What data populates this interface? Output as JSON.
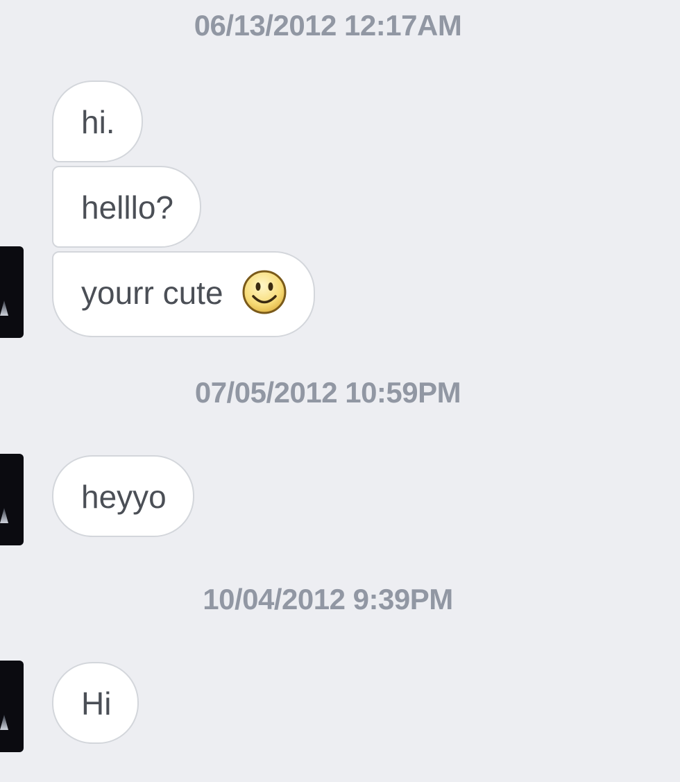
{
  "conversation": [
    {
      "timestamp": "06/13/2012 12:17AM",
      "messages": [
        "hi.",
        "helllo?",
        "yourr cute"
      ],
      "emoji": "smiley-icon"
    },
    {
      "timestamp": "07/05/2012 10:59PM",
      "messages": [
        "heyyo"
      ]
    },
    {
      "timestamp": "10/04/2012 9:39PM",
      "messages": [
        "Hi"
      ]
    }
  ],
  "colors": {
    "background": "#edeef2",
    "bubble": "#ffffff",
    "bubble_border": "#d3d6db",
    "timestamp_text": "#9197a3",
    "message_text": "#4b4f56"
  }
}
